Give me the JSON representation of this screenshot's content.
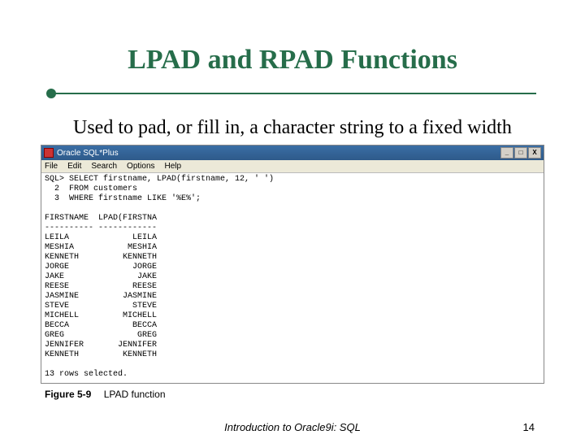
{
  "title": "LPAD and RPAD Functions",
  "body_text": "Used to pad, or fill in, a character string to a fixed width",
  "window": {
    "title": "Oracle SQL*Plus",
    "menus": [
      "File",
      "Edit",
      "Search",
      "Options",
      "Help"
    ],
    "min_label": "_",
    "max_label": "□",
    "close_label": "X"
  },
  "sql": {
    "prompt_line": "SQL> SELECT firstname, LPAD(firstname, 12, ' ')",
    "line2": "  2  FROM customers",
    "line3": "  3  WHERE firstname LIKE '%E%';",
    "header": "FIRSTNAME  LPAD(FIRSTNA",
    "divider": "---------- ------------",
    "rows": [
      {
        "c1": "LEILA",
        "c2": "       LEILA"
      },
      {
        "c1": "MESHIA",
        "c2": "      MESHIA"
      },
      {
        "c1": "KENNETH",
        "c2": "     KENNETH"
      },
      {
        "c1": "JORGE",
        "c2": "       JORGE"
      },
      {
        "c1": "JAKE",
        "c2": "        JAKE"
      },
      {
        "c1": "REESE",
        "c2": "       REESE"
      },
      {
        "c1": "JASMINE",
        "c2": "     JASMINE"
      },
      {
        "c1": "STEVE",
        "c2": "       STEVE"
      },
      {
        "c1": "MICHELL",
        "c2": "     MICHELL"
      },
      {
        "c1": "BECCA",
        "c2": "       BECCA"
      },
      {
        "c1": "GREG",
        "c2": "        GREG"
      },
      {
        "c1": "JENNIFER",
        "c2": "    JENNIFER"
      },
      {
        "c1": "KENNETH",
        "c2": "     KENNETH"
      }
    ],
    "status": "13 rows selected."
  },
  "caption": {
    "fignum": "Figure 5-9",
    "text": "LPAD function"
  },
  "footer": {
    "center": "Introduction to Oracle9i: SQL",
    "page": "14"
  }
}
